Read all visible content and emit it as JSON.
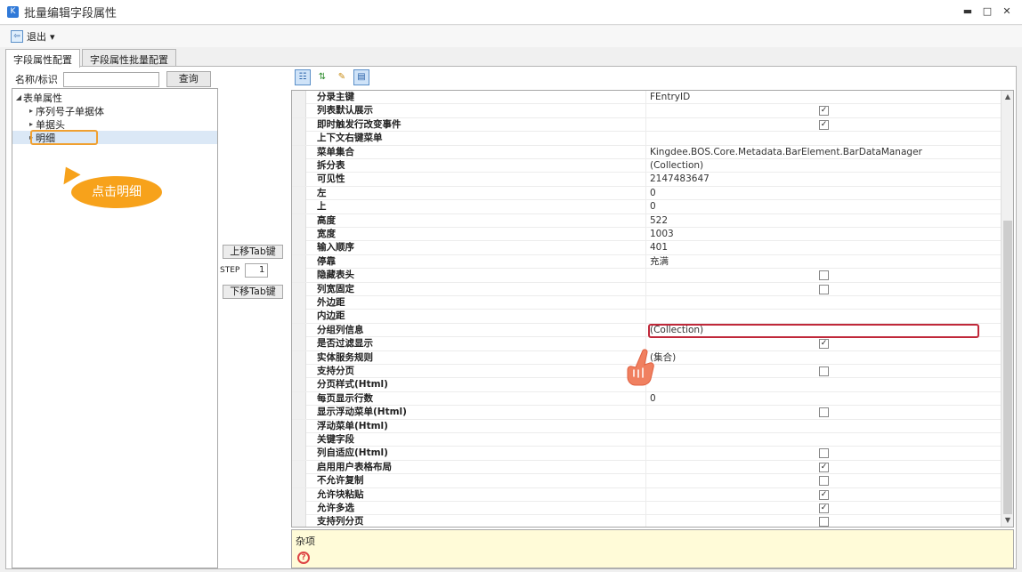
{
  "window": {
    "title": "批量编辑字段属性",
    "minimize": "▬",
    "maximize": "□",
    "close": "✕"
  },
  "menubar": {
    "exit_label": "退出",
    "exit_arrow": "▾"
  },
  "tabs": [
    {
      "label": "字段属性配置",
      "active": true
    },
    {
      "label": "字段属性批量配置",
      "active": false
    }
  ],
  "search": {
    "label": "名称/标识",
    "value": "",
    "button": "查询"
  },
  "tree": {
    "root": "表单属性",
    "children": [
      "序列号子单据体",
      "单据头",
      "明细"
    ],
    "selected": "明细"
  },
  "callout": {
    "text": "点击明细"
  },
  "mid": {
    "up_button": "上移Tab键",
    "step_label": "STEP",
    "step_value": "1",
    "down_button": "下移Tab键"
  },
  "properties": [
    {
      "name": "分录主键",
      "value": "FEntryID"
    },
    {
      "name": "列表默认展示",
      "check": true
    },
    {
      "name": "即时触发行改变事件",
      "check": true
    },
    {
      "name": "上下文右键菜单",
      "value": ""
    },
    {
      "name": "菜单集合",
      "value": "Kingdee.BOS.Core.Metadata.BarElement.BarDataManager"
    },
    {
      "name": "拆分表",
      "value": "(Collection)"
    },
    {
      "name": "可见性",
      "value": "2147483647"
    },
    {
      "name": "左",
      "value": "0"
    },
    {
      "name": "上",
      "value": "0"
    },
    {
      "name": "高度",
      "value": "522"
    },
    {
      "name": "宽度",
      "value": "1003"
    },
    {
      "name": "输入顺序",
      "value": "401"
    },
    {
      "name": "停靠",
      "value": "充满"
    },
    {
      "name": "隐藏表头",
      "check": false
    },
    {
      "name": "列宽固定",
      "check": false
    },
    {
      "name": "外边距",
      "value": ""
    },
    {
      "name": "内边距",
      "value": ""
    },
    {
      "name": "分组列信息",
      "value": "(Collection)"
    },
    {
      "name": "是否过滤显示",
      "check": true
    },
    {
      "name": "实体服务规则",
      "value": "(集合)"
    },
    {
      "name": "支持分页",
      "check": false
    },
    {
      "name": "分页样式(Html)",
      "value": ""
    },
    {
      "name": "每页显示行数",
      "value": "0"
    },
    {
      "name": "显示浮动菜单(Html)",
      "check": false
    },
    {
      "name": "浮动菜单(Html)",
      "value": ""
    },
    {
      "name": "关键字段",
      "value": ""
    },
    {
      "name": "列自适应(Html)",
      "check": false
    },
    {
      "name": "启用用户表格布局",
      "check": true
    },
    {
      "name": "不允许复制",
      "check": false
    },
    {
      "name": "允许块粘贴",
      "check": true
    },
    {
      "name": "允许多选",
      "check": true
    },
    {
      "name": "支持列分页",
      "check": false
    }
  ],
  "description": {
    "title": "杂项"
  },
  "colors": {
    "highlight_orange": "#f0a030",
    "callout_fill": "#f7a21b",
    "red_highlight": "#c0283a",
    "desc_bg": "#fffbd8"
  }
}
